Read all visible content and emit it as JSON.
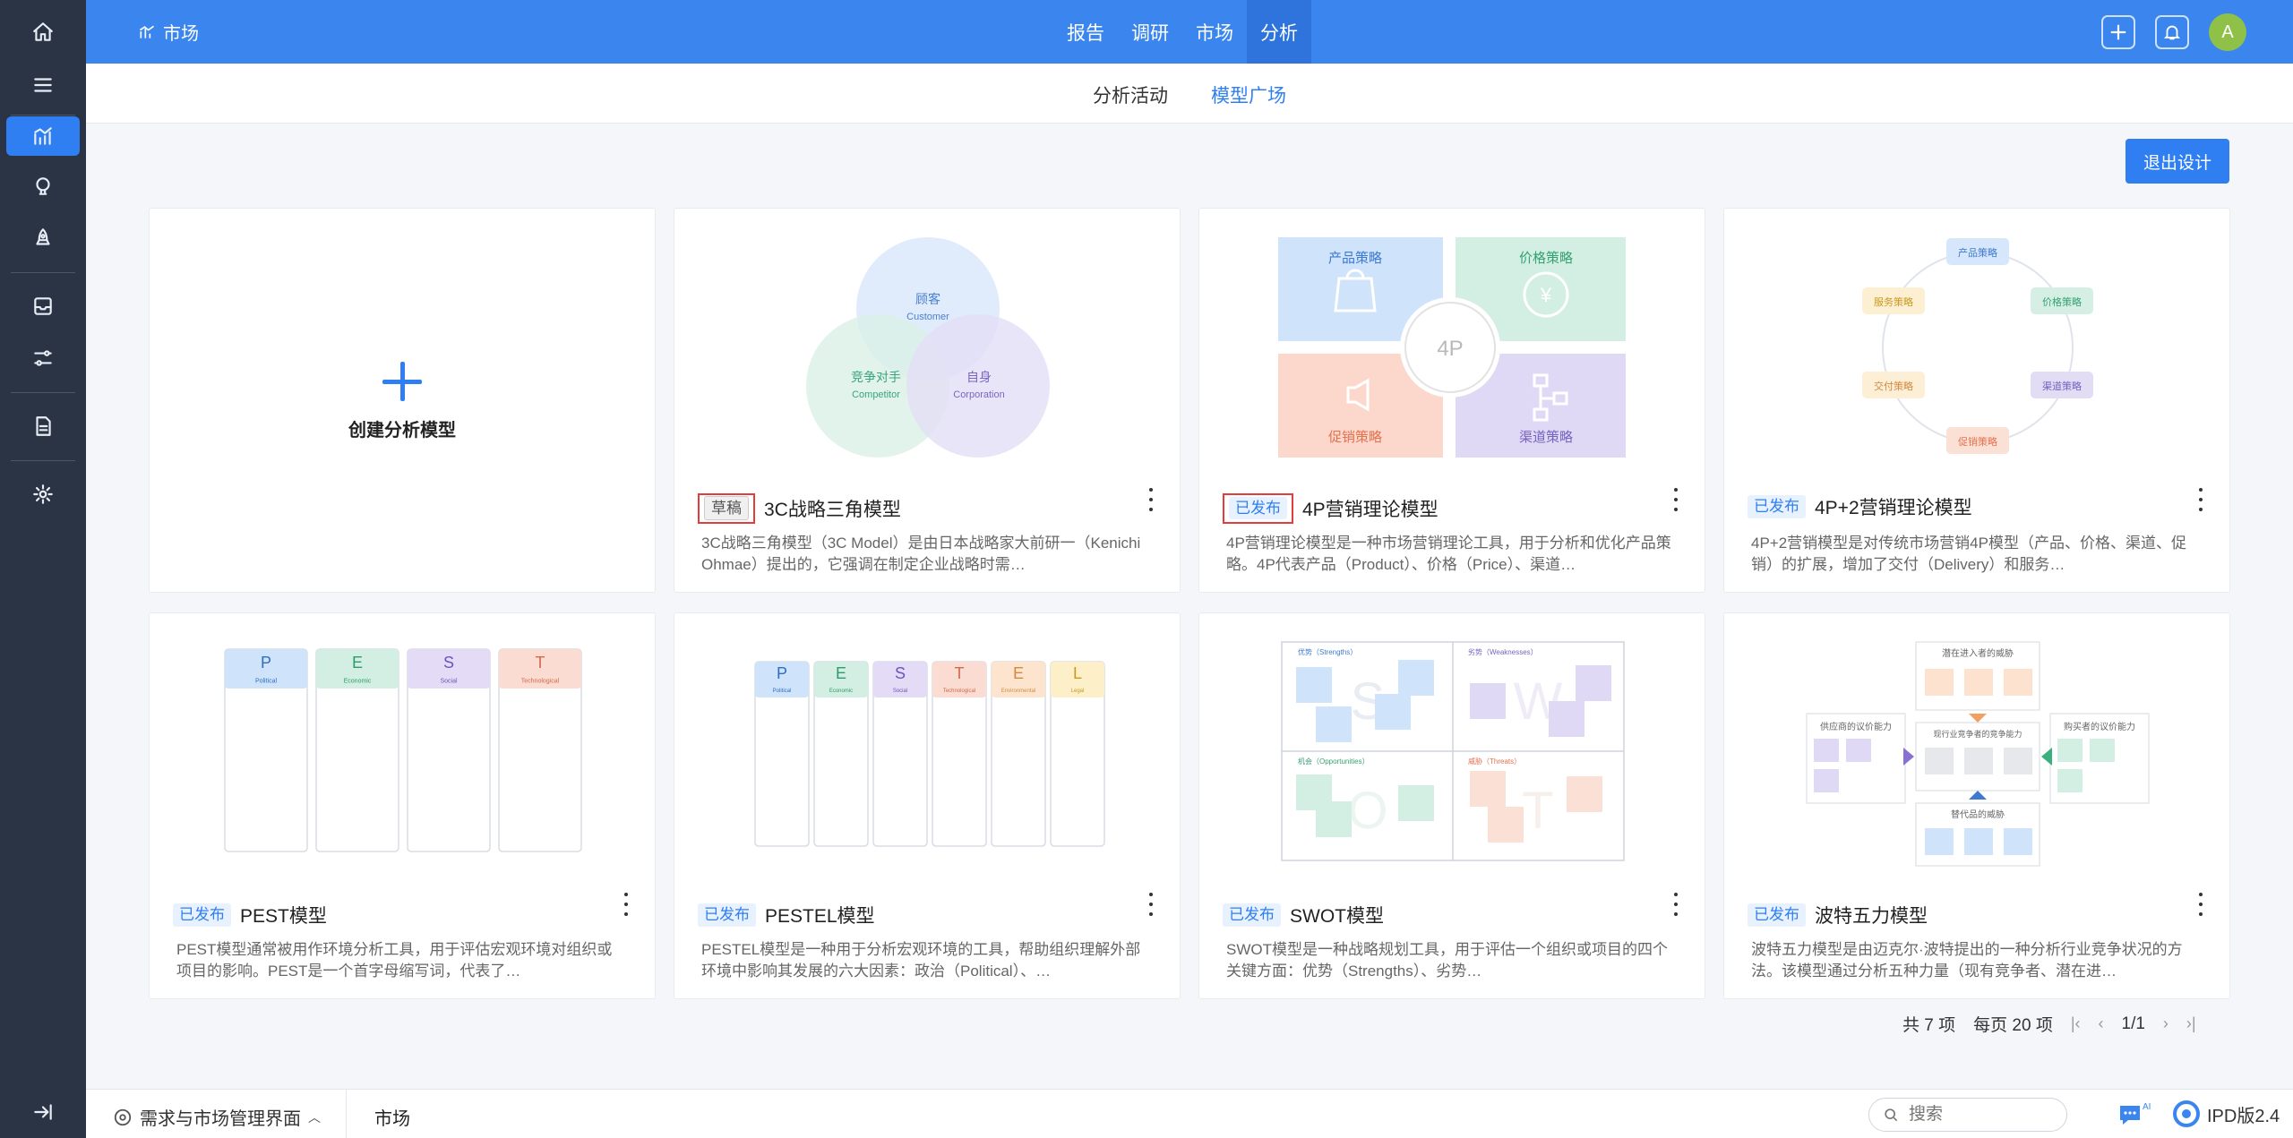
{
  "brand": {
    "title": "市场"
  },
  "topnav": [
    {
      "label": "报告"
    },
    {
      "label": "调研"
    },
    {
      "label": "市场"
    },
    {
      "label": "分析"
    }
  ],
  "user": {
    "avatar_initial": "A"
  },
  "subnav": [
    {
      "label": "分析活动"
    },
    {
      "label": "模型广场"
    }
  ],
  "toolbar": {
    "exit_label": "退出设计"
  },
  "create_card": {
    "label": "创建分析模型"
  },
  "cards": [
    {
      "status": "草稿",
      "title": "3C战略三角模型",
      "desc": "3C战略三角模型（3C Model）是由日本战略家大前研一（Kenichi Ohmae）提出的，它强调在制定企业战略时需…",
      "thumb": {
        "customer": "顾客",
        "customer_en": "Customer",
        "competitor": "竞争对手",
        "competitor_en": "Competitor",
        "self": "自身",
        "self_en": "Corporation"
      }
    },
    {
      "status": "已发布",
      "title": "4P营销理论模型",
      "desc": "4P营销理论模型是一种市场营销理论工具，用于分析和优化产品策略。4P代表产品（Product）、价格（Price）、渠道…",
      "thumb": {
        "product": "产品策略",
        "price": "价格策略",
        "promo": "促销策略",
        "channel": "渠道策略",
        "center": "4P"
      }
    },
    {
      "status": "已发布",
      "title": "4P+2营销理论模型",
      "desc": "4P+2营销模型是对传统市场营销4P模型（产品、价格、渠道、促销）的扩展，增加了交付（Delivery）和服务…",
      "thumb": {
        "n1": "产品策略",
        "n2": "价格策略",
        "n3": "渠道策略",
        "n4": "促销策略",
        "n5": "交付策略",
        "n6": "服务策略"
      }
    },
    {
      "status": "已发布",
      "title": "PEST模型",
      "desc": "PEST模型通常被用作环境分析工具，用于评估宏观环境对组织或项目的影响。PEST是一个首字母缩写词，代表了…",
      "thumb": {
        "cols": [
          {
            "letter": "P",
            "sub": "Political",
            "color": "#cfe3fb",
            "fg": "#2f6fc0"
          },
          {
            "letter": "E",
            "sub": "Economic",
            "color": "#d3efe3",
            "fg": "#2f9a6a"
          },
          {
            "letter": "S",
            "sub": "Social",
            "color": "#e4dcf6",
            "fg": "#6b55b8"
          },
          {
            "letter": "T",
            "sub": "Technological",
            "color": "#fbdcd2",
            "fg": "#d26a4a"
          }
        ]
      }
    },
    {
      "status": "已发布",
      "title": "PESTEL模型",
      "desc": "PESTEL模型是一种用于分析宏观环境的工具，帮助组织理解外部环境中影响其发展的六大因素：政治（Political）、…",
      "thumb": {
        "cols": [
          {
            "letter": "P",
            "sub": "Political",
            "color": "#cfe3fb",
            "fg": "#2f6fc0"
          },
          {
            "letter": "E",
            "sub": "Economic",
            "color": "#d3efe3",
            "fg": "#2f9a6a"
          },
          {
            "letter": "S",
            "sub": "Social",
            "color": "#e4dcf6",
            "fg": "#6b55b8"
          },
          {
            "letter": "T",
            "sub": "Technological",
            "color": "#fbdcd2",
            "fg": "#d26a4a"
          },
          {
            "letter": "E",
            "sub": "Environmental",
            "color": "#fde4cf",
            "fg": "#d38a3e"
          },
          {
            "letter": "L",
            "sub": "Legal",
            "color": "#fdefc8",
            "fg": "#c99a20"
          }
        ]
      }
    },
    {
      "status": "已发布",
      "title": "SWOT模型",
      "desc": "SWOT模型是一种战略规划工具，用于评估一个组织或项目的四个关键方面：优势（Strengths）、劣势…",
      "thumb": {
        "s": "优势（Strengths）",
        "w": "劣势（Weaknesses）",
        "o": "机会（Opportunities）",
        "t": "威胁（Threats）"
      }
    },
    {
      "status": "已发布",
      "title": "波特五力模型",
      "desc": "波特五力模型是由迈克尔·波特提出的一种分析行业竞争状况的方法。该模型通过分析五种力量（现有竞争者、潜在进…",
      "thumb": {
        "top": "潜在进入者的威胁",
        "left": "供应商的议价能力",
        "center": "现行业竞争者的竞争能力",
        "right": "购买者的议价能力",
        "bottom": "替代品的威胁"
      }
    }
  ],
  "pager": {
    "total": "共 7 项",
    "per_page": "每页 20 项",
    "page": "1/1"
  },
  "bottom": {
    "workspace": "需求与市场管理界面",
    "current": "市场",
    "search_placeholder": "搜索",
    "version": "IPD版2.4",
    "ai": "AI"
  }
}
